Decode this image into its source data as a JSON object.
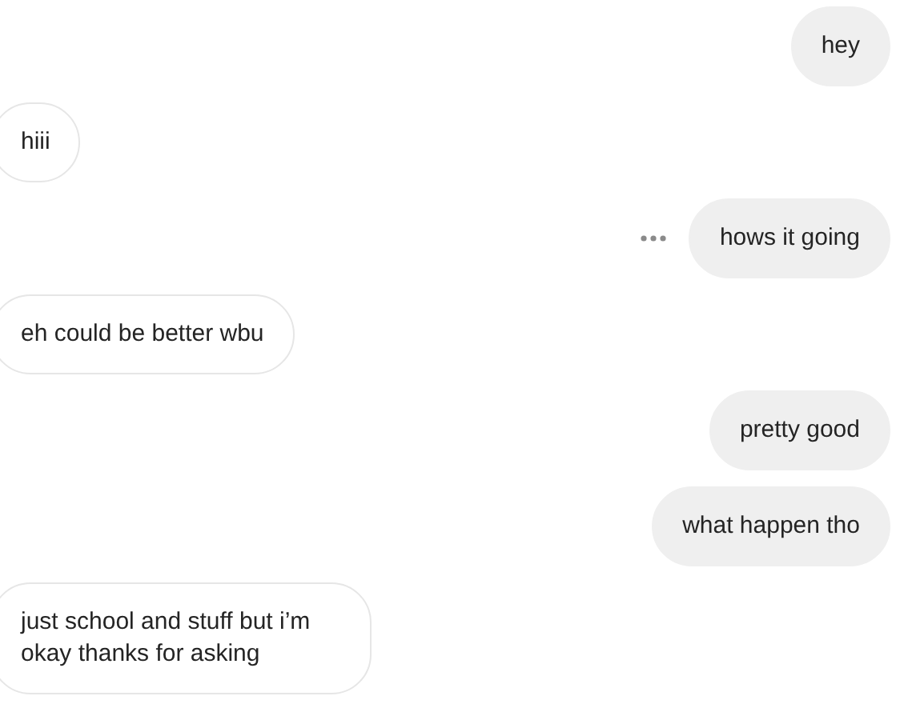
{
  "messages": [
    {
      "kind": "sent",
      "text": "hey",
      "hovered": false
    },
    {
      "kind": "received",
      "text": "hiii",
      "hovered": false
    },
    {
      "kind": "sent",
      "text": "hows it going",
      "hovered": true
    },
    {
      "kind": "received",
      "text": "eh could be better wbu",
      "hovered": false
    },
    {
      "kind": "sent",
      "text": "pretty good",
      "hovered": false
    },
    {
      "kind": "sent",
      "text": "what happen tho",
      "hovered": false
    },
    {
      "kind": "received",
      "text": "just school and stuff but i’m okay thanks for asking",
      "hovered": false
    }
  ]
}
